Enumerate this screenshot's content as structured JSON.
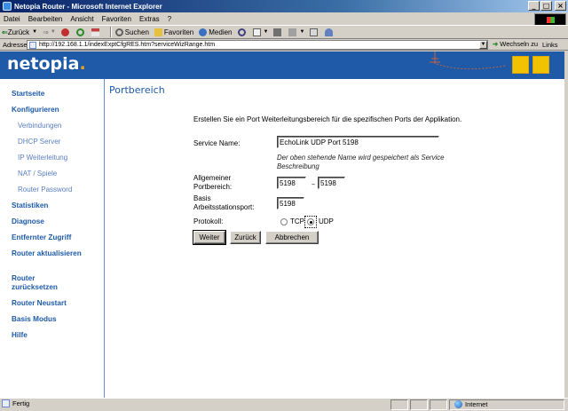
{
  "window": {
    "title": "Netopia Router - Microsoft Internet Explorer",
    "buttons": [
      "_",
      "□",
      "×"
    ]
  },
  "menu": [
    "Datei",
    "Bearbeiten",
    "Ansicht",
    "Favoriten",
    "Extras",
    "?"
  ],
  "toolbar": {
    "back_label": "Zurück",
    "search_label": "Suchen",
    "favorites_label": "Favoriten",
    "media_label": "Medien"
  },
  "address": {
    "label": "Adresse",
    "url": "http://192.168.1.1/indexExptCfgRES.htm?serviceWizRange.htm",
    "go_label": "Wechseln zu",
    "links_label": "Links"
  },
  "brand": {
    "logo": "netopia",
    "logo_dot": ".",
    "accent": "#1e5aa8",
    "logo_dot_color": "#f0a020"
  },
  "sidebar": {
    "items": [
      {
        "label": "Startseite",
        "type": "main"
      },
      {
        "label": "Konfigurieren",
        "type": "main"
      },
      {
        "label": "Verbindungen",
        "type": "sub"
      },
      {
        "label": "DHCP Server",
        "type": "sub"
      },
      {
        "label": "IP Weiterleitung",
        "type": "sub"
      },
      {
        "label": "NAT / Spiele",
        "type": "sub"
      },
      {
        "label": "Router Password",
        "type": "sub"
      },
      {
        "label": "Statistiken",
        "type": "main"
      },
      {
        "label": "Diagnose",
        "type": "main"
      },
      {
        "label": "Entfernter Zugriff",
        "type": "main"
      },
      {
        "label": "Router aktualisieren",
        "type": "main"
      },
      {
        "label": "Router zurücksetzen",
        "type": "main"
      },
      {
        "label": "Router Neustart",
        "type": "main"
      },
      {
        "label": "Basis Modus",
        "type": "main"
      },
      {
        "label": "Hilfe",
        "type": "main"
      }
    ]
  },
  "main": {
    "title": "Portbereich",
    "intro": "Erstellen Sie ein Port Weiterleitungsbereich für die spezifischen Ports der Applikation.",
    "service_name_label": "Service Name:",
    "service_name_value": "EchoLink UDP Port 5198",
    "service_hint": "Der oben stehende Name wird gespeichert als Service Beschreibung",
    "port_range_label": "Allgemeiner Portbereich:",
    "port_from": "5198",
    "port_dash": "–",
    "port_to": "5198",
    "base_port_label": "Basis Arbeitsstationsport:",
    "base_port": "5198",
    "protocol_label": "Protokoll:",
    "protocol_options": [
      "TCP",
      "UDP"
    ],
    "protocol_selected": "UDP",
    "buttons": {
      "next": "Weiter",
      "back": "Zurück",
      "cancel": "Abbrechen"
    }
  },
  "status": {
    "text": "Fertig",
    "zone": "Internet"
  }
}
